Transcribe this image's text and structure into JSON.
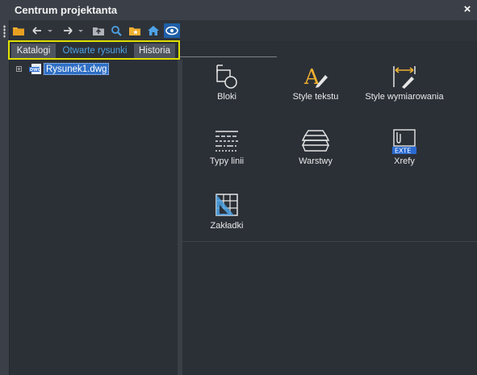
{
  "window": {
    "title": "Centrum projektanta",
    "close_glyph": "×"
  },
  "toolbar": {
    "buttons": [
      {
        "name": "load-folder-icon"
      },
      {
        "name": "back-arrow-icon"
      },
      {
        "name": "back-dropdown-icon"
      },
      {
        "name": "forward-arrow-icon"
      },
      {
        "name": "forward-dropdown-icon"
      },
      {
        "name": "up-folder-icon"
      },
      {
        "name": "search-icon"
      },
      {
        "name": "favorites-icon"
      },
      {
        "name": "home-icon"
      },
      {
        "name": "preview-eye-icon"
      }
    ]
  },
  "tabs": [
    {
      "label": "Katalogi",
      "active": false
    },
    {
      "label": "Otwarte rysunki",
      "active": true
    },
    {
      "label": "Historia",
      "active": false
    }
  ],
  "tree": {
    "expander": "+",
    "file_label": "Rysunek1.dwg",
    "file_icon_text": "DWG"
  },
  "content": {
    "items": [
      {
        "label": "Bloki",
        "icon": "blocks-icon"
      },
      {
        "label": "Style tekstu",
        "icon": "text-style-icon"
      },
      {
        "label": "Style wymiarowania",
        "icon": "dimension-style-icon"
      },
      {
        "label": "Typy linii",
        "icon": "linetype-icon"
      },
      {
        "label": "Warstwy",
        "icon": "layers-icon"
      },
      {
        "label": "Xrefy",
        "icon": "xref-icon",
        "badge": "EXTE"
      },
      {
        "label": "Zakładki",
        "icon": "layout-icon"
      }
    ]
  },
  "colors": {
    "accent_blue": "#4ea3e6",
    "highlight_frame": "#e0e000",
    "selection": "#2f6fc4",
    "icon_orange": "#f0b030"
  }
}
